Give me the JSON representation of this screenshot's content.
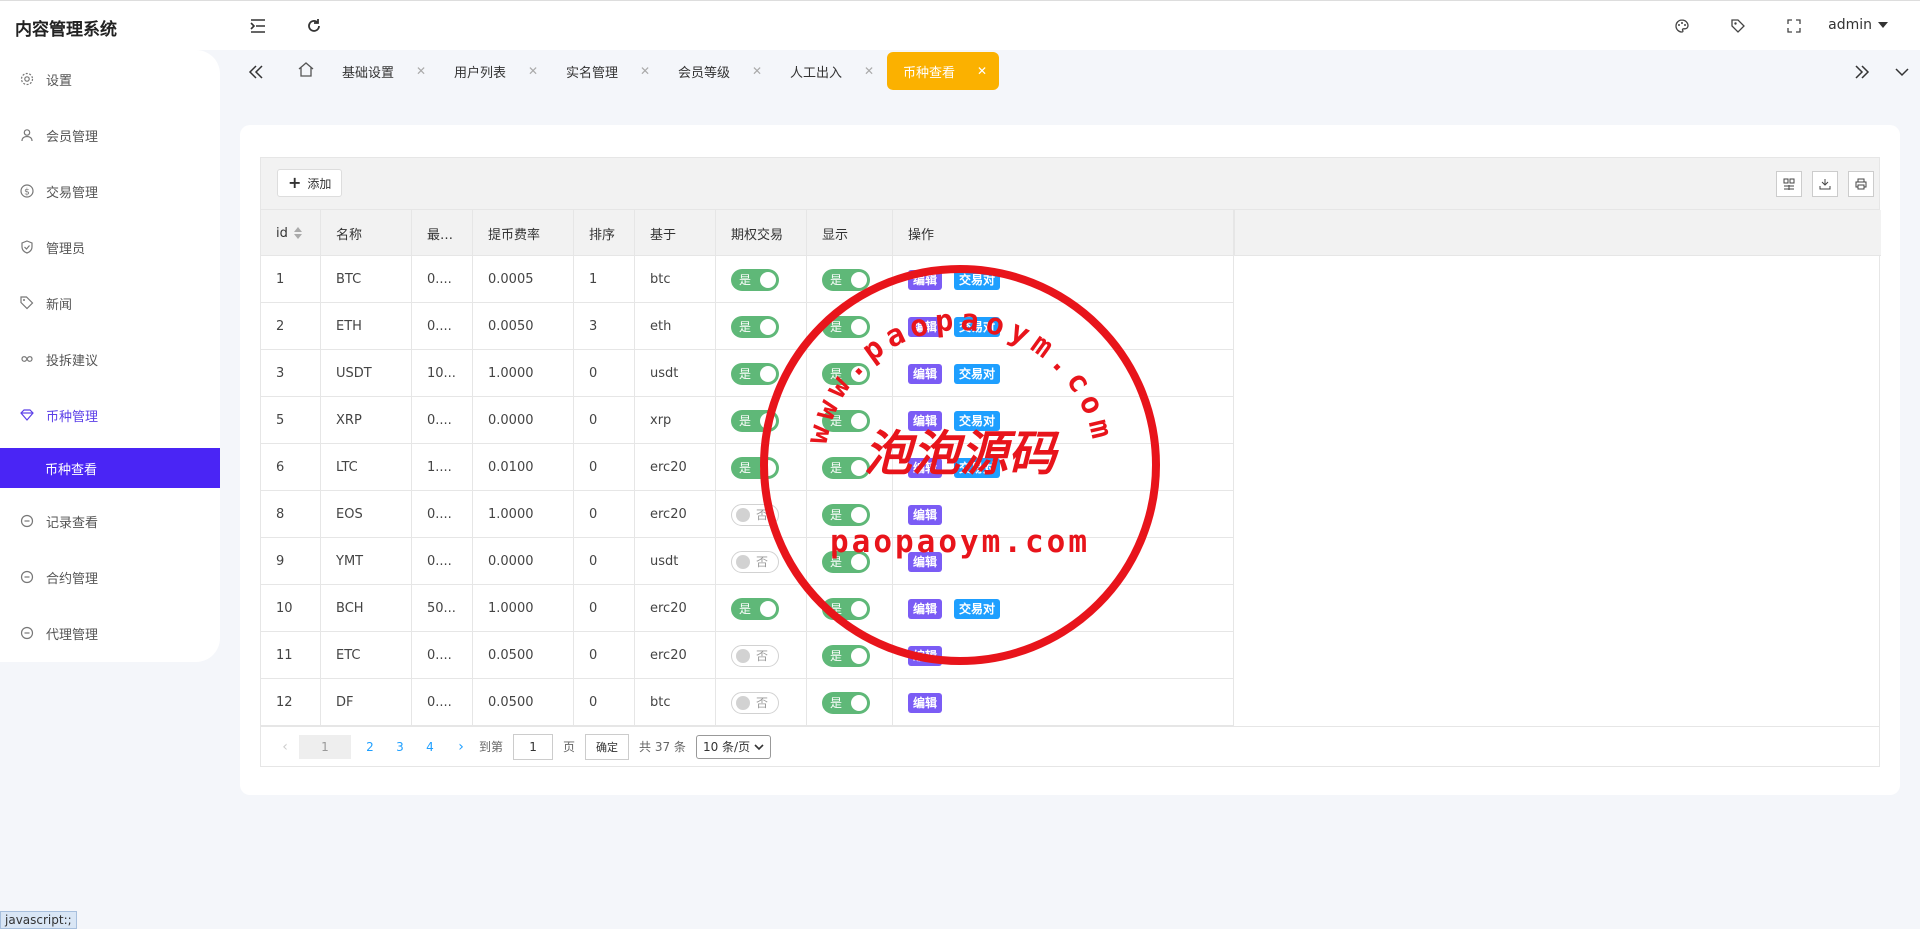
{
  "header": {
    "brand": "内容管理系统",
    "user": "admin",
    "icons": [
      "menu-fold-icon",
      "refresh-icon",
      "palette-icon",
      "tag-icon",
      "fullscreen-icon"
    ]
  },
  "sidebar": {
    "items": [
      {
        "label": "设置",
        "icon": "gear-icon"
      },
      {
        "label": "会员管理",
        "icon": "user-icon"
      },
      {
        "label": "交易管理",
        "icon": "dollar-icon"
      },
      {
        "label": "管理员",
        "icon": "shield-icon"
      },
      {
        "label": "新闻",
        "icon": "tag-icon"
      },
      {
        "label": "投拆建议",
        "icon": "link-icon"
      },
      {
        "label": "币种管理",
        "icon": "diamond-icon"
      },
      {
        "label": "记录查看",
        "icon": "clock-icon"
      },
      {
        "label": "合约管理",
        "icon": "clock-icon"
      },
      {
        "label": "代理管理",
        "icon": "clock-icon"
      }
    ],
    "sub_active": "币种查看"
  },
  "tabs": [
    "基础设置",
    "用户列表",
    "实名管理",
    "会员等级",
    "人工出入",
    "币种查看"
  ],
  "toolbar": {
    "add_label": "添加"
  },
  "table": {
    "columns": [
      "id",
      "名称",
      "最…",
      "提币费率",
      "排序",
      "基于",
      "期权交易",
      "显示",
      "操作"
    ],
    "rows": [
      {
        "id": "1",
        "name": "BTC",
        "min": "0....",
        "fee": "0.0005",
        "sort": "1",
        "base": "btc",
        "option": "是",
        "show": "是",
        "pair": true
      },
      {
        "id": "2",
        "name": "ETH",
        "min": "0....",
        "fee": "0.0050",
        "sort": "3",
        "base": "eth",
        "option": "是",
        "show": "是",
        "pair": true
      },
      {
        "id": "3",
        "name": "USDT",
        "min": "10...",
        "fee": "1.0000",
        "sort": "0",
        "base": "usdt",
        "option": "是",
        "show": "是",
        "pair": true
      },
      {
        "id": "5",
        "name": "XRP",
        "min": "0....",
        "fee": "0.0000",
        "sort": "0",
        "base": "xrp",
        "option": "是",
        "show": "是",
        "pair": true
      },
      {
        "id": "6",
        "name": "LTC",
        "min": "1....",
        "fee": "0.0100",
        "sort": "0",
        "base": "erc20",
        "option": "是",
        "show": "是",
        "pair": true
      },
      {
        "id": "8",
        "name": "EOS",
        "min": "0....",
        "fee": "1.0000",
        "sort": "0",
        "base": "erc20",
        "option": "否",
        "show": "是",
        "pair": false
      },
      {
        "id": "9",
        "name": "YMT",
        "min": "0....",
        "fee": "0.0000",
        "sort": "0",
        "base": "usdt",
        "option": "否",
        "show": "是",
        "pair": false
      },
      {
        "id": "10",
        "name": "BCH",
        "min": "50...",
        "fee": "1.0000",
        "sort": "0",
        "base": "erc20",
        "option": "是",
        "show": "是",
        "pair": true
      },
      {
        "id": "11",
        "name": "ETC",
        "min": "0....",
        "fee": "0.0500",
        "sort": "0",
        "base": "erc20",
        "option": "否",
        "show": "是",
        "pair": false
      },
      {
        "id": "12",
        "name": "DF",
        "min": "0....",
        "fee": "0.0500",
        "sort": "0",
        "base": "btc",
        "option": "否",
        "show": "是",
        "pair": false
      }
    ],
    "ops": {
      "edit": "编辑",
      "pair": "交易对"
    }
  },
  "pager": {
    "current": "1",
    "pages": [
      "2",
      "3",
      "4"
    ],
    "goto_label": "到第",
    "goto_value": "1",
    "page_unit": "页",
    "confirm": "确定",
    "total": "共 37 条",
    "per_page": "10 条/页"
  },
  "statusbar": "javascript:;",
  "watermark": {
    "top_text": "www.paopaoym.com",
    "center_text": "泡泡源码",
    "bottom_text": "paopaoym.com",
    "color": "#e8141b"
  }
}
